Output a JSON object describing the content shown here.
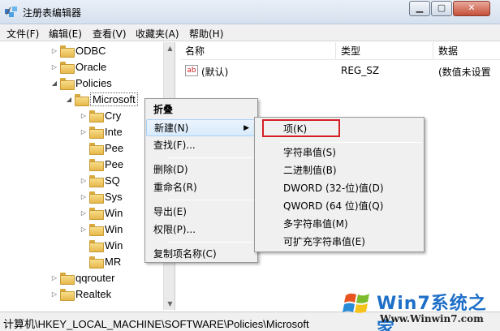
{
  "window": {
    "title": "注册表编辑器"
  },
  "menubar": [
    "文件(F)",
    "编辑(E)",
    "查看(V)",
    "收藏夹(A)",
    "帮助(H)"
  ],
  "tree": {
    "items": [
      "ODBC",
      "Oracle",
      "Policies",
      "Microsoft",
      "Cry",
      "Inte",
      "Pee",
      "Pee",
      "SQ",
      "Sys",
      "Win",
      "Win",
      "Win",
      "MR",
      "qqrouter",
      "Realtek"
    ]
  },
  "list": {
    "columns": [
      "名称",
      "类型",
      "数据"
    ],
    "rows": [
      {
        "name": "(默认)",
        "type": "REG_SZ",
        "data": "(数值未设置"
      }
    ]
  },
  "context_menu": {
    "items": [
      "折叠",
      "新建(N)",
      "查找(F)...",
      "删除(D)",
      "重命名(R)",
      "导出(E)",
      "权限(P)...",
      "复制项名称(C)"
    ]
  },
  "submenu": {
    "items": [
      "项(K)",
      "字符串值(S)",
      "二进制值(B)",
      "DWORD (32-位)值(D)",
      "QWORD (64 位)值(Q)",
      "多字符串值(M)",
      "可扩充字符串值(E)"
    ]
  },
  "status": {
    "path": "计算机\\HKEY_LOCAL_MACHINE\\SOFTWARE\\Policies\\Microsoft"
  },
  "watermark": {
    "brand": "Win7系统之家",
    "url": "Www.Winwin7.com"
  },
  "colors": {
    "highlight_box": "#d51f26",
    "accent": "#1e6fc7"
  }
}
